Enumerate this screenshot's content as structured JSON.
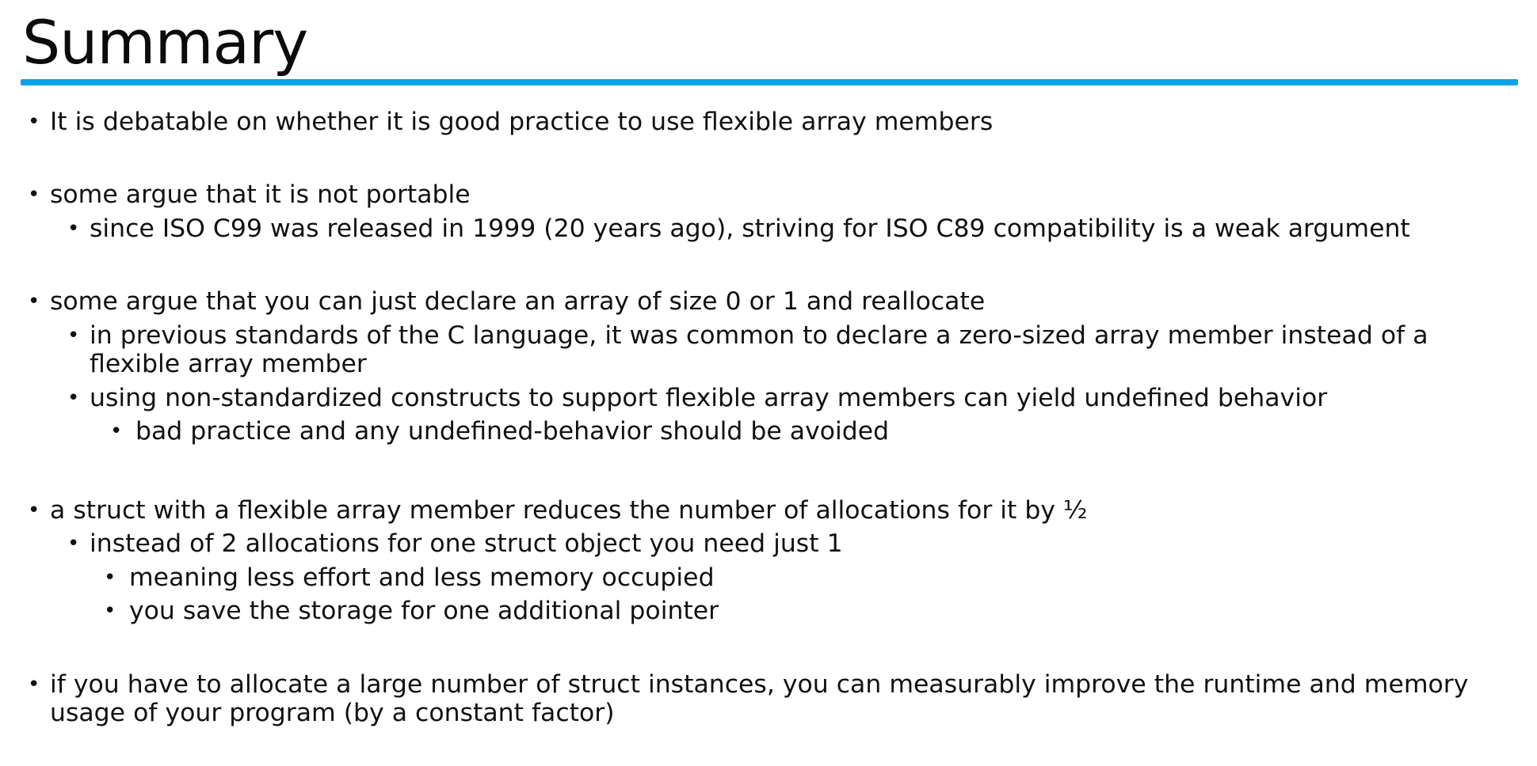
{
  "slide": {
    "title": "Summary",
    "accent_color": "#0aa3e6",
    "bullet_glyph": "•",
    "items": [
      {
        "level": 1,
        "text": "It is debatable on whether it is good practice to use flexible array members"
      },
      {
        "level": 1,
        "text": "some argue that it is not portable"
      },
      {
        "level": 2,
        "text": "since ISO C99 was released in 1999 (20 years ago), striving for ISO C89 compatibility is a weak argument"
      },
      {
        "level": 1,
        "text": "some argue that you can just declare an array of size 0 or 1 and reallocate"
      },
      {
        "level": 2,
        "text": "in previous standards of the C language, it was common to declare a zero-sized array member instead of a flexible array member"
      },
      {
        "level": 2,
        "text": "using non-standardized constructs to support flexible array members can yield undefined behavior"
      },
      {
        "level": 3,
        "text": "bad practice and any undefined-behavior should be avoided"
      },
      {
        "level": 1,
        "text": "a struct with a flexible array member reduces the number of allocations for it by ½"
      },
      {
        "level": 2,
        "text": "instead of 2 allocations for one struct object you need just 1"
      },
      {
        "level": 3,
        "text": "meaning less effort and less memory occupied"
      },
      {
        "level": 3,
        "text": "you save the storage for one additional pointer"
      },
      {
        "level": 1,
        "text": "if you have to allocate a large number of struct instances, you can measurably improve the runtime and memory usage of your program (by a constant factor)"
      }
    ]
  }
}
